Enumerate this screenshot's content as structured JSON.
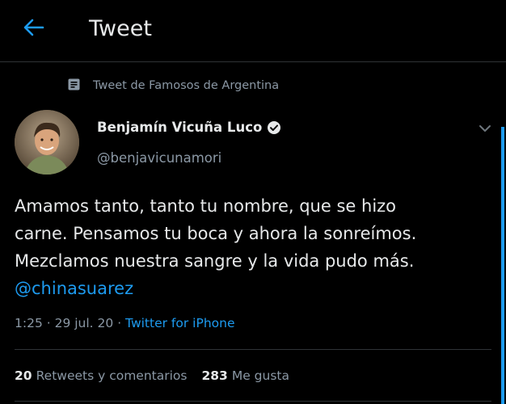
{
  "header": {
    "back_icon": "arrow-left-icon",
    "title": "Tweet"
  },
  "context": {
    "icon": "list-icon",
    "label": "Tweet de Famosos de Argentina"
  },
  "author": {
    "name": "Benjamín Vicuña Luco",
    "handle": "@benjavicunamori",
    "verified": true,
    "verified_icon": "verified-badge-icon"
  },
  "tweet": {
    "lines": [
      "Amamos tanto, tanto tu nombre,  que se hizo",
      "carne. Pensamos tu boca y ahora la sonreímos.",
      "Mezclamos nuestra sangre y la vida pudo más."
    ],
    "mention": "@chinasuarez"
  },
  "meta": {
    "time": "1:25",
    "sep1": " · ",
    "date": "29 jul. 20",
    "sep2": " · ",
    "source": "Twitter for iPhone"
  },
  "stats": {
    "retweets_count": "20",
    "retweets_label": "Retweets y comentarios",
    "likes_count": "283",
    "likes_label": "Me gusta"
  },
  "colors": {
    "background": "#000000",
    "accent": "#1d9bf0",
    "text_primary": "#e7e9ea",
    "text_secondary": "#8b98a5",
    "divider": "#2f3336"
  }
}
